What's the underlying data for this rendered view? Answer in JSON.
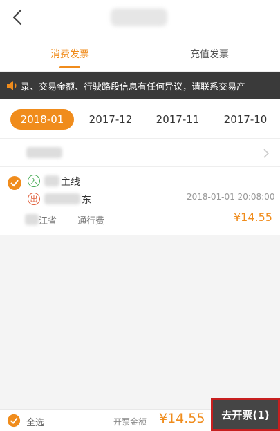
{
  "tabs": [
    {
      "label": "消费发票",
      "active": true
    },
    {
      "label": "充值发票",
      "active": false
    }
  ],
  "notice": {
    "text": "录、交易金额、行驶路段信息有任何异议，请联系交易产"
  },
  "months": [
    {
      "label": "2018-01",
      "active": true
    },
    {
      "label": "2017-12",
      "active": false
    },
    {
      "label": "2017-11",
      "active": false
    },
    {
      "label": "2017-10",
      "active": false
    }
  ],
  "record": {
    "entry_badge": "入",
    "entry_text": "主线",
    "exit_badge": "出",
    "exit_text": "东",
    "datetime": "2018-01-01 20:08:00",
    "province": "江省",
    "fee_type": "通行费",
    "amount": "¥14.55"
  },
  "footer": {
    "select_all": "全选",
    "total_label": "开票金额",
    "total_amount": "¥14.55",
    "issue_button": "去开票(1)"
  },
  "colors": {
    "accent": "#f08c1c",
    "notice_bg": "#3a3a3a",
    "entry": "#4cae5a",
    "exit": "#e0613e",
    "button_bg": "#454545",
    "highlight_border": "#c71f1f"
  }
}
